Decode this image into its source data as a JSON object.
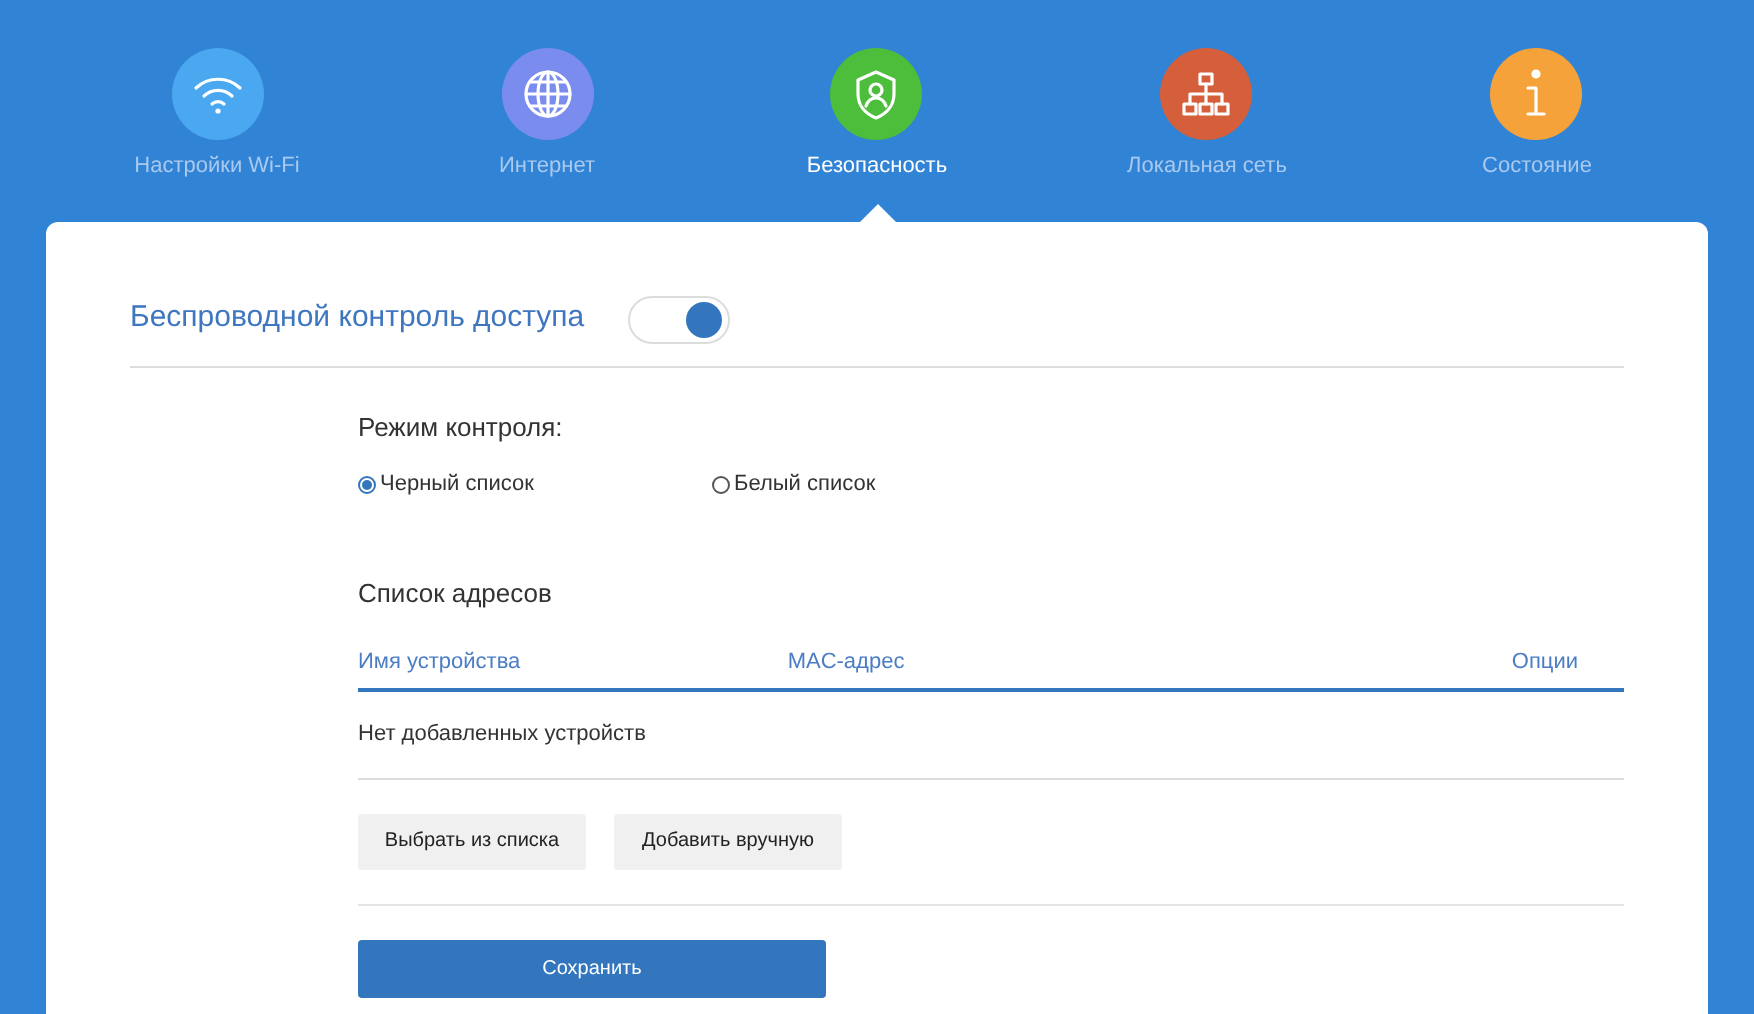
{
  "nav": [
    {
      "label": "Настройки Wi-Fi",
      "kind": "wifi",
      "color": "#4aa8f0",
      "selected": false
    },
    {
      "label": "Интернет",
      "kind": "globe",
      "color": "#7b8cef",
      "selected": false
    },
    {
      "label": "Безопасность",
      "kind": "shield",
      "color": "#4dbd3c",
      "selected": true
    },
    {
      "label": "Локальная сеть",
      "kind": "network",
      "color": "#d55f3b",
      "selected": false
    },
    {
      "label": "Состояние",
      "kind": "info",
      "color": "#f5a23a",
      "selected": false
    }
  ],
  "section": {
    "title": "Беспроводной контроль доступа",
    "on": true
  },
  "mode": {
    "label": "Режим контроля:",
    "options": [
      {
        "label": "Черный список",
        "selected": true
      },
      {
        "label": "Белый список",
        "selected": false
      }
    ]
  },
  "address_list": {
    "title": "Список адресов",
    "columns": [
      "Имя устройства",
      "MAC-адрес",
      "Опции"
    ],
    "empty": "Нет добавленных устройств"
  },
  "buttons": [
    "Выбрать из списка",
    "Добавить вручную"
  ],
  "save": "Сохранить"
}
